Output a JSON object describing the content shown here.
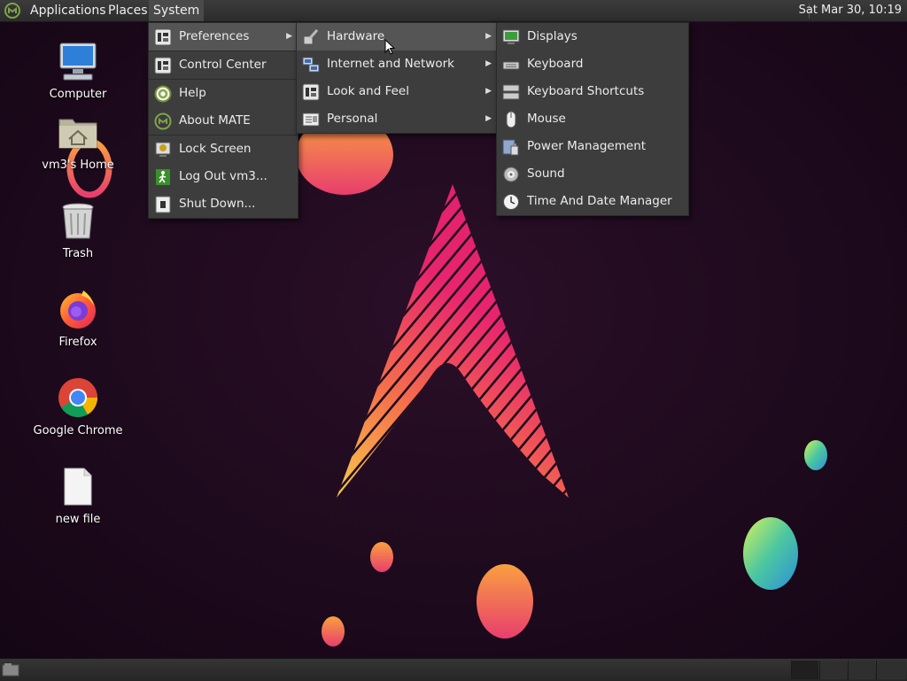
{
  "top_panel": {
    "menus": [
      "Applications",
      "Places",
      "System"
    ],
    "clock": "Sat Mar 30, 10:19"
  },
  "desktop_icons": [
    {
      "label": "Computer",
      "icon": "computer-icon"
    },
    {
      "label": "vm3's Home",
      "icon": "home-folder-icon"
    },
    {
      "label": "Trash",
      "icon": "trash-icon"
    },
    {
      "label": "Firefox",
      "icon": "firefox-icon"
    },
    {
      "label": "Google Chrome",
      "icon": "chrome-icon"
    },
    {
      "label": "new file",
      "icon": "file-icon"
    }
  ],
  "system_menu": {
    "items": [
      {
        "label": "Preferences",
        "icon": "preferences-icon",
        "submenu": true
      },
      {
        "label": "Control Center",
        "icon": "control-center-icon"
      },
      {
        "label": "Help",
        "icon": "help-icon"
      },
      {
        "label": "About MATE",
        "icon": "mate-icon"
      },
      {
        "label": "Lock Screen",
        "icon": "lock-screen-icon"
      },
      {
        "label": "Log Out vm3...",
        "icon": "log-out-icon"
      },
      {
        "label": "Shut Down...",
        "icon": "shut-down-icon"
      }
    ]
  },
  "preferences_menu": {
    "items": [
      {
        "label": "Hardware",
        "icon": "hardware-icon",
        "submenu": true
      },
      {
        "label": "Internet and Network",
        "icon": "network-icon",
        "submenu": true
      },
      {
        "label": "Look and Feel",
        "icon": "look-and-feel-icon",
        "submenu": true
      },
      {
        "label": "Personal",
        "icon": "personal-icon",
        "submenu": true
      }
    ]
  },
  "hardware_menu": {
    "items": [
      {
        "label": "Displays",
        "icon": "displays-icon"
      },
      {
        "label": "Keyboard",
        "icon": "keyboard-icon"
      },
      {
        "label": "Keyboard Shortcuts",
        "icon": "keyboard-shortcuts-icon"
      },
      {
        "label": "Mouse",
        "icon": "mouse-icon"
      },
      {
        "label": "Power Management",
        "icon": "power-management-icon"
      },
      {
        "label": "Sound",
        "icon": "sound-icon"
      },
      {
        "label": "Time And Date Manager",
        "icon": "clock-icon"
      }
    ]
  },
  "colors": {
    "panel": "#2f2f2f",
    "menu_bg": "#3d3d3d",
    "menu_highlight": "#555555",
    "wallpaper_bg": "#1c0a1c",
    "accent_pink": "#e8246e",
    "accent_orange": "#f7931e"
  }
}
